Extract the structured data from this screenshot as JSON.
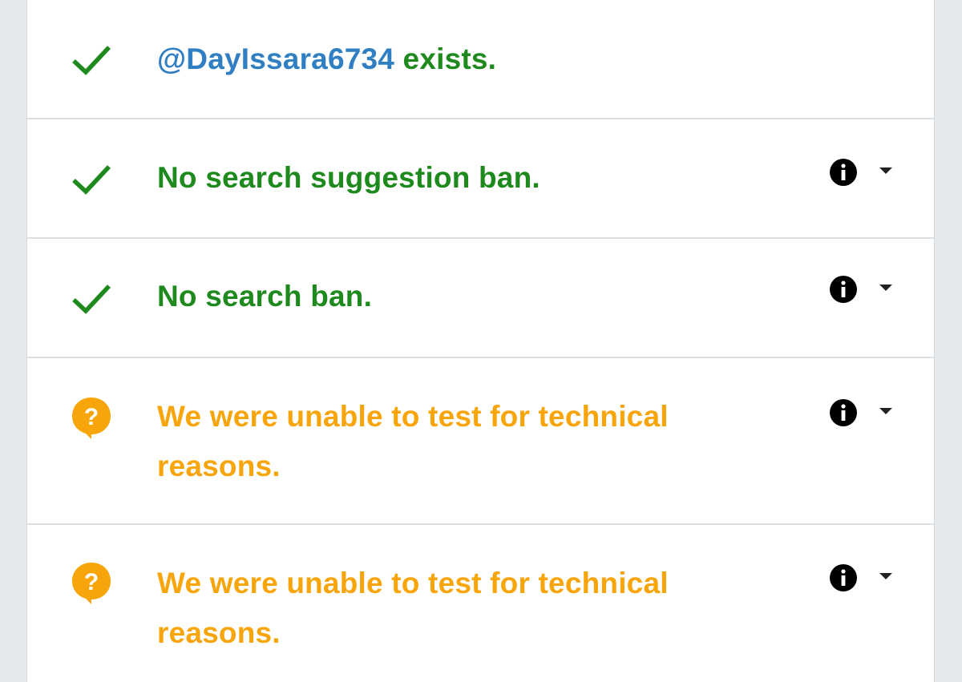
{
  "results": [
    {
      "status": "ok",
      "status_icon": "check-icon",
      "handle": "@DayIssara6734",
      "text": " exists.",
      "has_controls": false
    },
    {
      "status": "ok",
      "status_icon": "check-icon",
      "text": "No search suggestion ban.",
      "has_controls": true
    },
    {
      "status": "ok",
      "status_icon": "check-icon",
      "text": "No search ban.",
      "has_controls": true
    },
    {
      "status": "unknown",
      "status_icon": "question-bubble-icon",
      "text": "We were unable to test for technical reasons.",
      "has_controls": true
    },
    {
      "status": "unknown",
      "status_icon": "question-bubble-icon",
      "text": "We were unable to test for technical reasons.",
      "has_controls": true
    }
  ],
  "colors": {
    "ok": "#1e8a1e",
    "warn": "#f7a50b",
    "handle": "#2f7fc2",
    "icon_dark": "#000000"
  },
  "controls": {
    "info_icon": "info-icon",
    "expand_icon": "chevron-down-icon"
  }
}
